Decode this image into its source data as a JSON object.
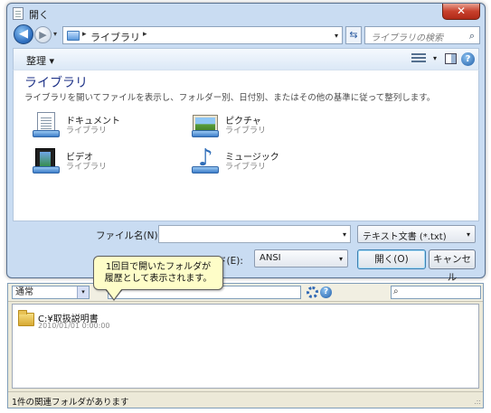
{
  "dialog": {
    "title": "開く",
    "close_glyph": "✕",
    "nav": {
      "back_glyph": "◀",
      "forward_glyph": "▶",
      "dropdown_glyph": "▾",
      "address_sep1": "▸",
      "address_text": "ライブラリ",
      "address_sep2": "▸",
      "refresh_glyph": "⇆",
      "search_placeholder": "ライブラリの検索",
      "search_glyph": "⌕"
    },
    "cmdbar": {
      "organize_label": "整理 ▾",
      "view_dropdown": "▾",
      "help_glyph": "?"
    },
    "library": {
      "title": "ライブラリ",
      "description": "ライブラリを開いてファイルを表示し、フォルダー別、日付別、またはその他の基準に従って整列します。",
      "items": [
        {
          "name": "ドキュメント",
          "sub": "ライブラリ",
          "icon": "documents-library-icon"
        },
        {
          "name": "ピクチャ",
          "sub": "ライブラリ",
          "icon": "pictures-library-icon"
        },
        {
          "name": "ビデオ",
          "sub": "ライブラリ",
          "icon": "videos-library-icon"
        },
        {
          "name": "ミュージック",
          "sub": "ライブラリ",
          "icon": "music-library-icon"
        }
      ],
      "music_glyph": "♪"
    },
    "bottom": {
      "filename_label": "ファイル名(N):",
      "filename_value": "",
      "filename_drop": "▾",
      "filetype_value": "テキスト文書 (*.txt)",
      "filetype_drop": "▾",
      "encoding_label": "ド(E):",
      "encoding_value": "ANSI",
      "encoding_drop": "▾",
      "open_label": "開く(O)",
      "cancel_label": "キャンセル"
    }
  },
  "callout": {
    "line1": "1回目で開いたフォルダが",
    "line2": "履歴として表示されます。"
  },
  "history": {
    "mode_value": "通常",
    "mode_drop": "▾",
    "info_glyph": "?",
    "search_glyph": "⌕",
    "items": [
      {
        "path": "C:¥取扱説明書",
        "date": "2010/01/01 0:00:00"
      }
    ],
    "status": "1件の関連フォルダがあります",
    "grip": ".::"
  }
}
